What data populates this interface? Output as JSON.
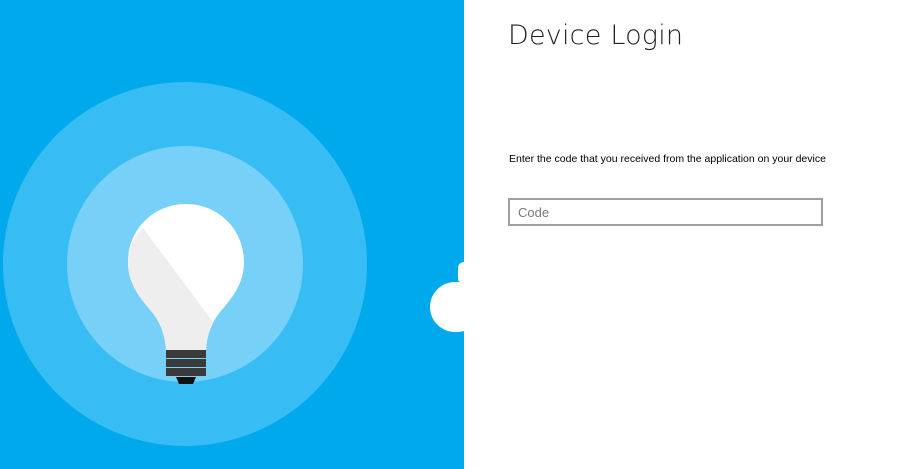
{
  "header": {
    "title": "Device Login"
  },
  "form": {
    "instructions": "Enter the code that you received from the application on your device",
    "code_placeholder": "Code",
    "code_value": ""
  },
  "hero": {
    "icon": "lightbulb-icon",
    "colors": {
      "background": "#00a9ec",
      "ring_outer": "#37bdf3",
      "ring_inner": "#76d0f8",
      "bulb_light": "#ffffff",
      "bulb_shade": "#eeeeee",
      "bulb_base": "#3a3a3a"
    }
  }
}
